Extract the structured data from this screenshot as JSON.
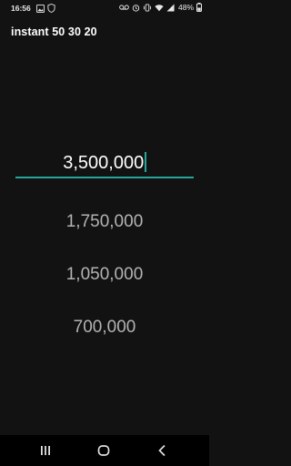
{
  "status_bar": {
    "time": "16:56",
    "battery": "48%",
    "icons_left": [
      "image-icon",
      "shield-icon"
    ],
    "icons_right": [
      "voicemail-icon",
      "alarm-icon",
      "vibrate-icon",
      "wifi-icon",
      "signal-icon",
      "battery-icon"
    ]
  },
  "app": {
    "title": "instant 50 30 20"
  },
  "input": {
    "value": "3,500,000",
    "accent_color": "#26a69a"
  },
  "results": [
    {
      "value": "1,750,000"
    },
    {
      "value": "1,050,000"
    },
    {
      "value": "700,000"
    }
  ],
  "nav_bar": {
    "buttons": [
      "recent-apps",
      "home",
      "back"
    ]
  }
}
